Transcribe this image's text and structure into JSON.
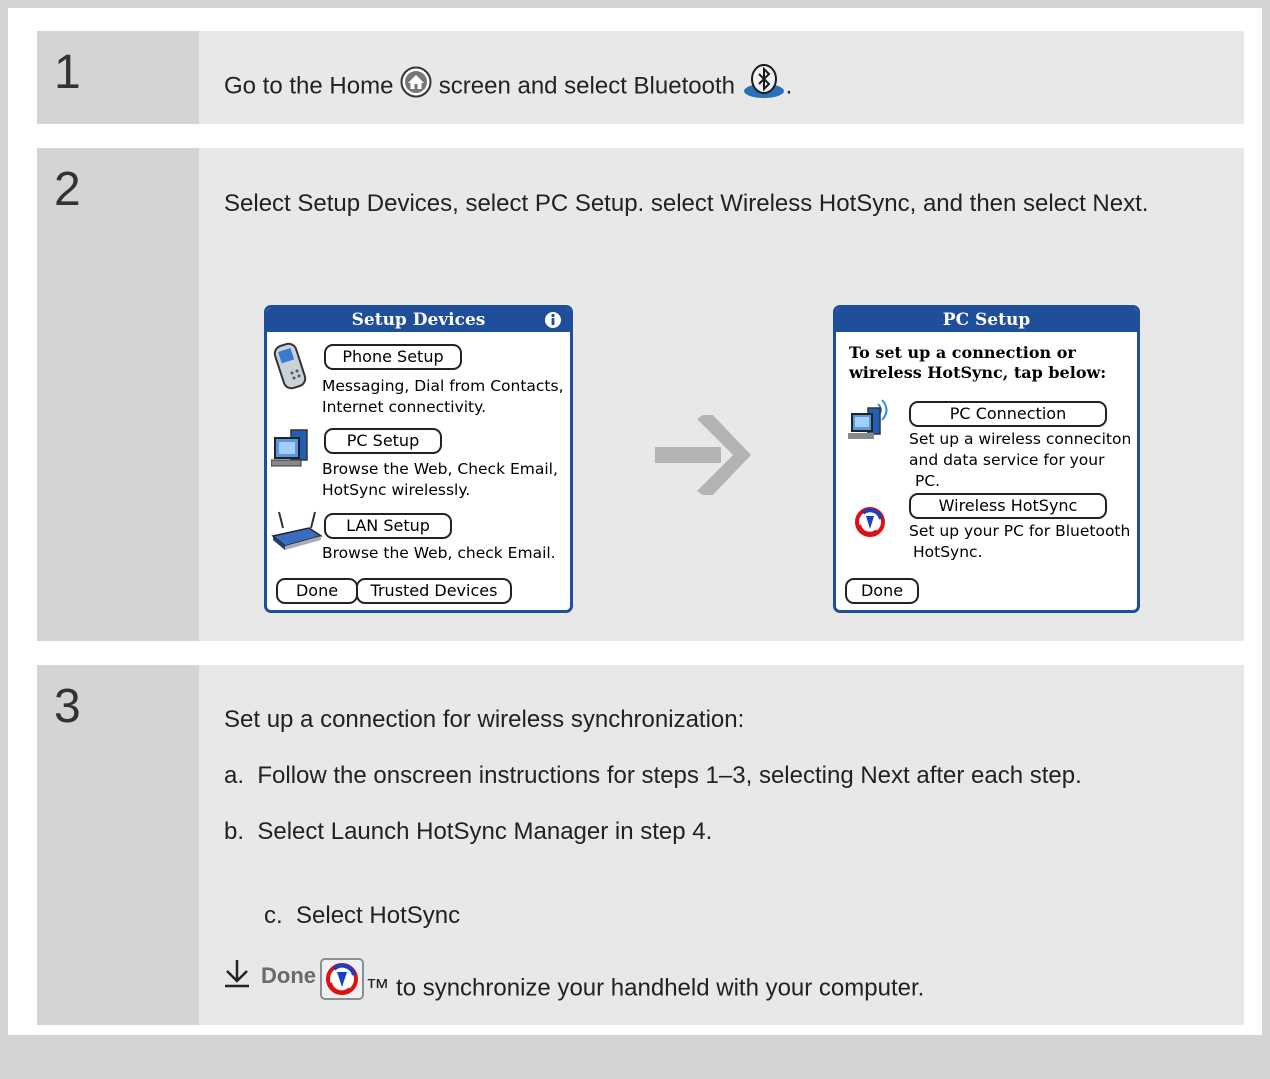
{
  "steps": [
    {
      "number": "1",
      "text_before": "Go to the Home",
      "text_middle": "screen and select Bluetooth",
      "text_after": "."
    },
    {
      "number": "2",
      "text": "Select Setup Devices, select PC Setup. select Wireless HotSync, and then select Next.",
      "setup_devices": {
        "title": "Setup Devices",
        "phone_button": "Phone Setup",
        "phone_desc_1": "Messaging, Dial from Contacts,",
        "phone_desc_2": "Internet connectivity.",
        "pc_button": "PC Setup",
        "pc_desc_1": "Browse the Web, Check Email,",
        "pc_desc_2": "HotSync wirelessly.",
        "lan_button": "LAN Setup",
        "lan_desc": "Browse the Web, check Email.",
        "done_button": "Done",
        "trusted_button": "Trusted Devices"
      },
      "pc_setup": {
        "title": "PC Setup",
        "heading_1": "To set up a connection or",
        "heading_2": "wireless HotSync, tap below:",
        "pc_connection_button": "PC Connection",
        "pc_connection_desc_1": "Set up a wireless conneciton",
        "pc_connection_desc_2": "and data service for your",
        "pc_connection_desc_3": "PC.",
        "wireless_button": "Wireless HotSync",
        "wireless_desc_1": "Set up your PC for Bluetooth",
        "wireless_desc_2": "HotSync.",
        "done_button": "Done"
      }
    },
    {
      "number": "3",
      "intro": "Set up a connection for wireless synchronization:",
      "a": "a.  Follow the onscreen instructions for steps 1–3, selecting Next after each step.",
      "b": "b.  Select Launch HotSync Manager in step 4.",
      "c_before": "c.  Select HotSync",
      "c_after": "™ to synchronize your handheld with your computer.",
      "done": "Done"
    }
  ],
  "colors": {
    "palm_blue": "#1f4f9a",
    "step_bg": "#e8e8e8",
    "number_bg": "#d4d4d4",
    "arrow": "#b3b3b3"
  },
  "icons": [
    "home-icon",
    "bluetooth-icon",
    "phone-icon",
    "pc-icon",
    "router-icon",
    "info-icon",
    "pc-wireless-icon",
    "hotsync-icon",
    "arrow-right-icon",
    "down-arrow-icon"
  ]
}
